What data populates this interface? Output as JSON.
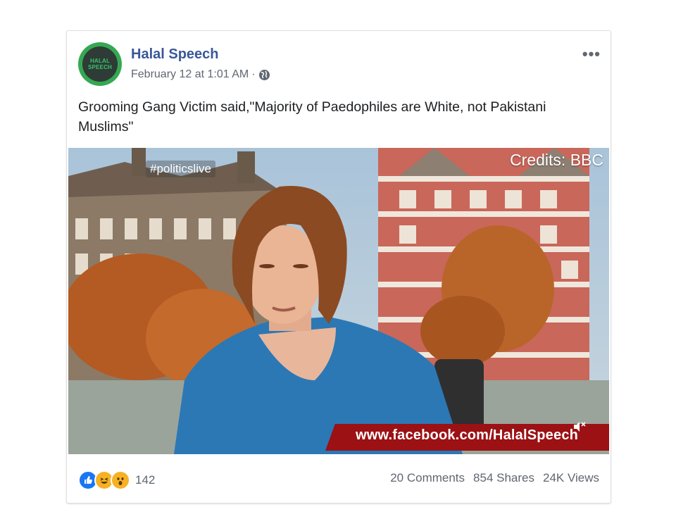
{
  "post": {
    "page_name": "Halal Speech",
    "avatar_text_line1": "HALAL",
    "avatar_text_line2": "SPEECH",
    "timestamp": "February 12 at 1:01 AM",
    "separator": "·",
    "privacy_icon": "globe-icon",
    "more_label": "•••",
    "caption": "Grooming Gang Victim said,\"Majority of Paedophiles are White, not Pakistani Muslims\""
  },
  "video": {
    "hashtag": "#politicslive",
    "credits": "Credits: BBC",
    "banner_text": "www.facebook.com/HalalSpeech",
    "mute_icon": "mute-icon"
  },
  "footer": {
    "reaction_icons": [
      "like-icon",
      "haha-icon",
      "wow-icon"
    ],
    "reaction_count": "142",
    "comments": "20 Comments",
    "shares": "854 Shares",
    "views": "24K Views"
  },
  "colors": {
    "brand_blue": "#385898",
    "meta_gray": "#606770",
    "banner_red": "#9b1114",
    "avatar_green": "#34a853"
  }
}
